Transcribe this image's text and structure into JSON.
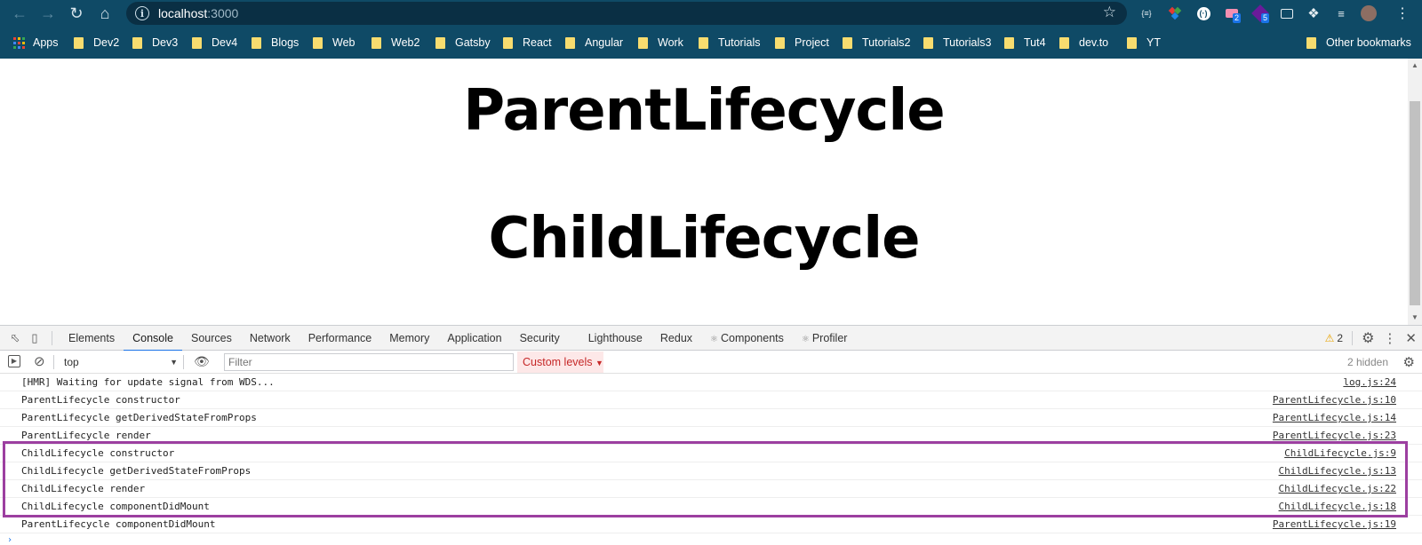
{
  "browser": {
    "url_host": "localhost",
    "url_port": ":3000",
    "extension_badges": [
      "2",
      "5"
    ],
    "bookmarks": [
      {
        "label": "Apps"
      },
      {
        "label": "Dev2"
      },
      {
        "label": "Dev3"
      },
      {
        "label": "Dev4"
      },
      {
        "label": "Blogs"
      },
      {
        "label": "Web"
      },
      {
        "label": "Web2"
      },
      {
        "label": "Gatsby"
      },
      {
        "label": "React"
      },
      {
        "label": "Angular"
      },
      {
        "label": "Work"
      },
      {
        "label": "Tutorials"
      },
      {
        "label": "Project"
      },
      {
        "label": "Tutorials2"
      },
      {
        "label": "Tutorials3"
      },
      {
        "label": "Tut4"
      },
      {
        "label": "dev.to"
      },
      {
        "label": "YT"
      }
    ],
    "other_bookmarks": "Other bookmarks"
  },
  "page": {
    "heading_parent": "ParentLifecycle",
    "heading_child": "ChildLifecycle"
  },
  "devtools": {
    "tabs": [
      "Elements",
      "Console",
      "Sources",
      "Network",
      "Performance",
      "Memory",
      "Application",
      "Security",
      "Lighthouse",
      "Redux",
      "Components",
      "Profiler"
    ],
    "active_tab": "Console",
    "warning_count": "2",
    "context": "top",
    "filter_placeholder": "Filter",
    "levels_label": "Custom levels",
    "hidden_label": "2 hidden",
    "logs": [
      {
        "message": "[HMR] Waiting for update signal from WDS...",
        "source": "log.js:24"
      },
      {
        "message": "ParentLifecycle constructor",
        "source": "ParentLifecycle.js:10"
      },
      {
        "message": "ParentLifecycle getDerivedStateFromProps",
        "source": "ParentLifecycle.js:14"
      },
      {
        "message": "ParentLifecycle render",
        "source": "ParentLifecycle.js:23"
      },
      {
        "message": "ChildLifecycle constructor",
        "source": "ChildLifecycle.js:9"
      },
      {
        "message": "ChildLifecycle getDerivedStateFromProps",
        "source": "ChildLifecycle.js:13"
      },
      {
        "message": "ChildLifecycle render",
        "source": "ChildLifecycle.js:22"
      },
      {
        "message": "ChildLifecycle componentDidMount",
        "source": "ChildLifecycle.js:18"
      },
      {
        "message": "ParentLifecycle componentDidMount",
        "source": "ParentLifecycle.js:19"
      }
    ],
    "prompt_symbol": "›"
  },
  "colors": {
    "chrome_bg": "#0f4a66",
    "highlight_border": "#9c3fa0",
    "active_tab_underline": "#1a73e8"
  }
}
